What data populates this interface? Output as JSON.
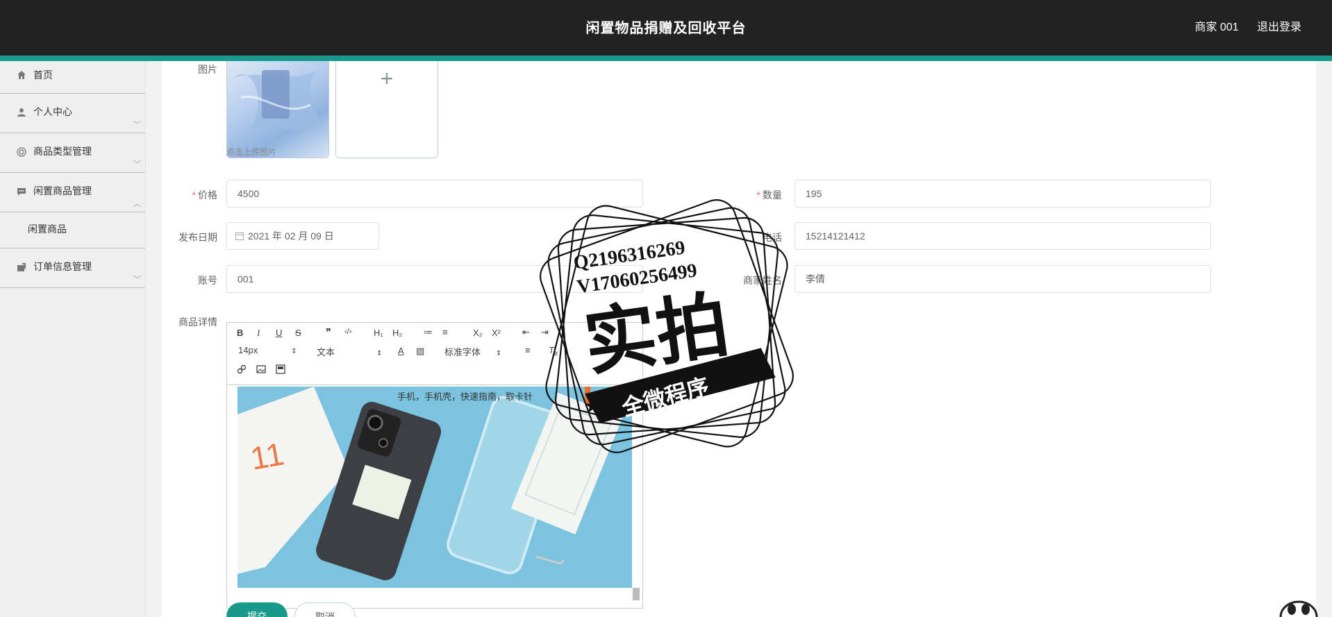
{
  "header": {
    "title": "闲置物品捐赠及回收平台",
    "user": "商家 001",
    "logout": "退出登录"
  },
  "sidebar": {
    "items": [
      {
        "label": "首页",
        "icon": "home-icon"
      },
      {
        "label": "个人中心",
        "icon": "user-icon"
      },
      {
        "label": "商品类型管理",
        "icon": "category-icon"
      },
      {
        "label": "闲置商品管理",
        "icon": "chat-icon"
      },
      {
        "label": "订单信息管理",
        "icon": "order-icon"
      }
    ],
    "sub_items": [
      {
        "label": "闲置商品"
      }
    ]
  },
  "form": {
    "image_label": "图片",
    "upload_hint": "点击上传图片",
    "price_label": "价格",
    "price_value": "4500",
    "quantity_label": "数量",
    "quantity_value": "195",
    "date_label": "发布日期",
    "date_value": "2021 年 02 月 09 日",
    "phone_label": "电话",
    "phone_value": "15214121412",
    "account_label": "账号",
    "account_value": "001",
    "merchant_label": "商家姓名",
    "merchant_value": "李倩",
    "detail_label": "商品详情",
    "submit": "提交",
    "cancel": "取消"
  },
  "editor": {
    "toolbar_row1": [
      "B",
      "I",
      "U",
      "S",
      "❞",
      "‹/›",
      "H₁",
      "H₂",
      "≔",
      "≡",
      "X₂",
      "X²",
      "⇤",
      "⇥"
    ],
    "font_size": "14px",
    "block_type": "文本",
    "font_family": "标准字体",
    "caption": "手机，手机壳，快速指南，取卡针"
  },
  "watermark": {
    "line1": "Q2196316269",
    "line2": "V17060256499",
    "big": "实拍",
    "ribbon": "全微程序"
  },
  "colors": {
    "header_bg": "#222222",
    "accent": "#179a8a",
    "sidebar_bg": "#efefef"
  }
}
